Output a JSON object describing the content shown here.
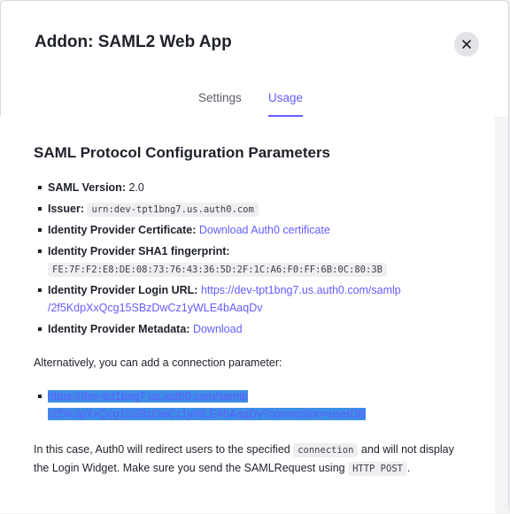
{
  "modal": {
    "title": "Addon: SAML2 Web App",
    "close_icon": "close-icon",
    "tabs": [
      {
        "label": "Settings",
        "active": false
      },
      {
        "label": "Usage",
        "active": true
      }
    ]
  },
  "usage": {
    "section_title": "SAML Protocol Configuration Parameters",
    "params": {
      "saml_version_label": "SAML Version:",
      "saml_version_value": "2.0",
      "issuer_label": "Issuer:",
      "issuer_value": "urn:dev-tpt1bng7.us.auth0.com",
      "cert_label": "Identity Provider Certificate:",
      "cert_link": "Download Auth0 certificate",
      "sha1_label": "Identity Provider SHA1 fingerprint:",
      "sha1_value": "FE:7F:F2:E8:DE:08:73:76:43:36:5D:2F:1C:A6:F0:FF:6B:0C:80:3B",
      "login_url_label": "Identity Provider Login URL:",
      "login_url_line1": "https://dev-tpt1bng7.us.auth0.com/samlp",
      "login_url_line2": "/2f5KdpXxQcg15SBzDwCz1yWLE4bAaqDv",
      "metadata_label": "Identity Provider Metadata:",
      "metadata_link": "Download"
    },
    "alt_intro": "Alternatively, you can add a connection parameter:",
    "alt_url_line1": "https://dev-tpt1bng7.us.auth0.com/samlp",
    "alt_url_line2": "/2f5KdpXxQcg15SBzDwCz1yWLE4bAaqDv?connection=userDB",
    "note_part1": "In this case, Auth0 will redirect users to the specified",
    "note_code1": "connection",
    "note_part2": "and will not display the Login Widget. Make sure you send the SAMLRequest using",
    "note_code2": "HTTP POST",
    "note_part3": "."
  },
  "colors": {
    "accent": "#635dff",
    "selection": "#3d8ee6"
  }
}
